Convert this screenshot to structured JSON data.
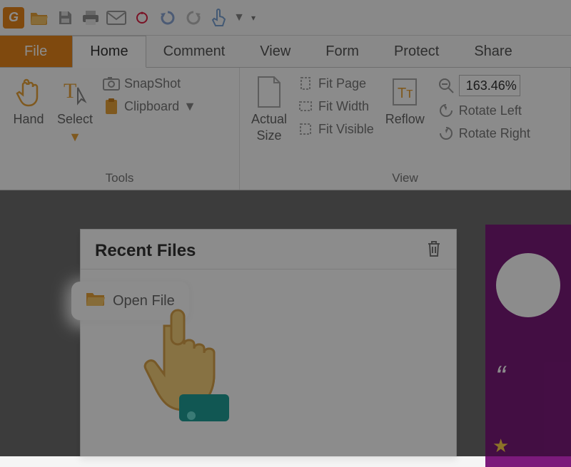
{
  "app_badge": "G",
  "tabs": {
    "file": "File",
    "home": "Home",
    "comment": "Comment",
    "view": "View",
    "form": "Form",
    "protect": "Protect",
    "share": "Share"
  },
  "groups": {
    "tools_label": "Tools",
    "view_label": "View"
  },
  "ribbon": {
    "hand": "Hand",
    "select": "Select",
    "snapshot": "SnapShot",
    "clipboard": "Clipboard",
    "actual_size_line1": "Actual",
    "actual_size_line2": "Size",
    "fit_page": "Fit Page",
    "fit_width": "Fit Width",
    "fit_visible": "Fit Visible",
    "reflow": "Reflow",
    "zoom_value": "163.46%",
    "rotate_left": "Rotate Left",
    "rotate_right": "Rotate Right"
  },
  "start": {
    "recent_title": "Recent Files",
    "open_file": "Open File"
  },
  "promo": {
    "quote_mark": "“"
  }
}
